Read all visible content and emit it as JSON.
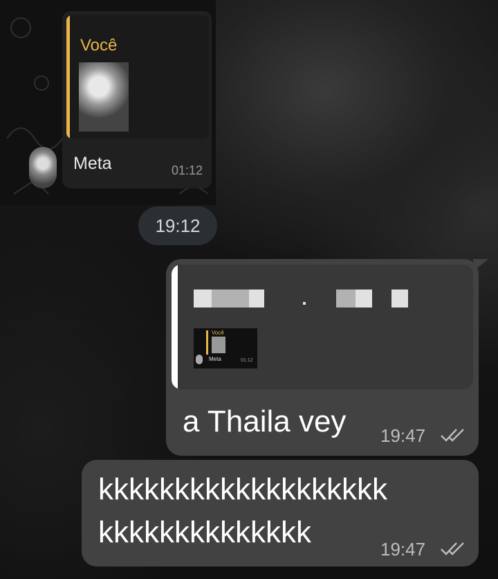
{
  "quoted_screenshot": {
    "reply_author": "Você",
    "message": "Meta",
    "time": "01:12"
  },
  "date_pill": "19:12",
  "message_1": {
    "mini_quote": {
      "author": "Você",
      "message": "Meta",
      "time": "01:12"
    },
    "text": "a Thaila vey",
    "time": "19:47",
    "status_icon": "double-check-icon"
  },
  "message_2": {
    "line1": "kkkkkkkkkkkkkkkkkkk",
    "line2": "kkkkkkkkkkkkkk",
    "time": "19:47",
    "status_icon": "double-check-icon"
  },
  "colors": {
    "accent_gold": "#e9b54a",
    "bubble": "#424242",
    "pill": "#2b2f33"
  }
}
